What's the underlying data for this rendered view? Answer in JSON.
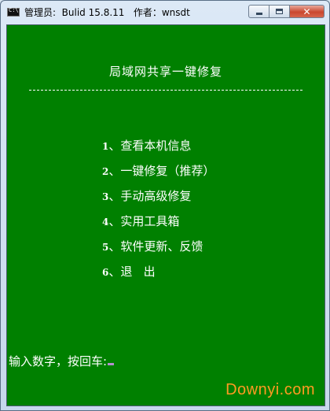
{
  "window": {
    "title": "管理员:  Bulid 15.8.11   作者：wnsdt",
    "icon": "console-icon",
    "controls": {
      "minimize_icon": "minimize-icon",
      "maximize_icon": "maximize-icon",
      "close_icon": "close-icon",
      "close_glyph": "✕"
    }
  },
  "console": {
    "heading": "局域网共享一键修复",
    "menu": [
      {
        "num": "1",
        "sep": "、",
        "label": "查看本机信息"
      },
      {
        "num": "2",
        "sep": "、",
        "label": "一键修复（推荐）"
      },
      {
        "num": "3",
        "sep": "、",
        "label": "手动高级修复"
      },
      {
        "num": "4",
        "sep": "、",
        "label": "实用工具箱"
      },
      {
        "num": "5",
        "sep": "、",
        "label": "软件更新、反馈"
      },
      {
        "num": "6",
        "sep": "、",
        "label": "退   出"
      }
    ],
    "prompt": "输入数字，按回车:"
  },
  "watermark": "Downyi.com",
  "colors": {
    "console_bg": "#008000",
    "console_text": "#ffffff",
    "cursor": "#b48fd0",
    "watermark": "#ff9a22",
    "close_button": "#c9472f"
  }
}
